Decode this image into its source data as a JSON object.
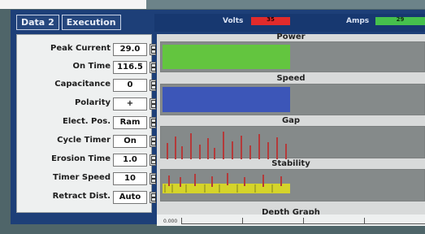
{
  "tabs": [
    {
      "label": "Data 2"
    },
    {
      "label": "Execution"
    }
  ],
  "meters": {
    "volts_label": "Volts",
    "volts_value": "35",
    "amps_label": "Amps",
    "amps_value": "29",
    "volts_color": "#e12b2b",
    "amps_color": "#46c04d"
  },
  "params": [
    {
      "label": "Peak Current",
      "value": "29.0"
    },
    {
      "label": "On Time",
      "value": "116.5"
    },
    {
      "label": "Capacitance",
      "value": "0"
    },
    {
      "label": "Polarity",
      "value": "+"
    },
    {
      "label": "Elect. Pos.",
      "value": "Ram"
    },
    {
      "label": "Cycle Timer",
      "value": "On"
    },
    {
      "label": "Erosion Time",
      "value": "1.0"
    },
    {
      "label": "Timer Speed",
      "value": "10"
    },
    {
      "label": "Retract Dist.",
      "value": "Auto"
    }
  ],
  "graphs": {
    "power_title": "Power",
    "speed_title": "Speed",
    "gap_title": "Gap",
    "stability_title": "Stability",
    "depth_title": "Depth Graph",
    "depth_scale": "0.000",
    "power_color": "#63c53f",
    "speed_color": "#3c56b8",
    "gap_color": "#b43a3a",
    "stability_color": "#d5d42a"
  }
}
